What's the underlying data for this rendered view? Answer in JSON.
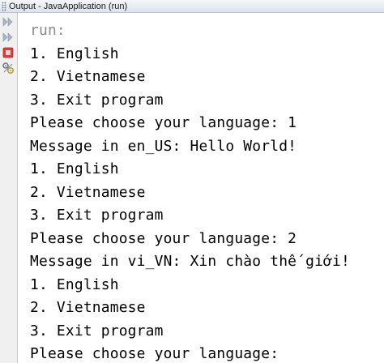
{
  "window": {
    "title": "Output - JavaApplication (run)"
  },
  "toolbar": {
    "buttons": [
      {
        "icon": "rerun-icon"
      },
      {
        "icon": "rerun-with-params-icon"
      },
      {
        "icon": "stop-icon"
      },
      {
        "icon": "settings-icon"
      }
    ]
  },
  "output": {
    "lines": [
      {
        "text": "run:",
        "kind": "meta"
      },
      {
        "text": "1. English"
      },
      {
        "text": "2. Vietnamese"
      },
      {
        "text": "3. Exit program"
      },
      {
        "text": "Please choose your language: 1"
      },
      {
        "text": "Message in en_US: Hello World!"
      },
      {
        "text": "1. English"
      },
      {
        "text": "2. Vietnamese"
      },
      {
        "text": "3. Exit program"
      },
      {
        "text": "Please choose your language: 2"
      },
      {
        "text": "Message in vi_VN: Xin chào thế giới!"
      },
      {
        "text": "1. English"
      },
      {
        "text": "2. Vietnamese"
      },
      {
        "text": "3. Exit program"
      },
      {
        "text": "Please choose your language:"
      }
    ]
  },
  "colors": {
    "meta_text": "#8a8a8a",
    "stop_button": "#d9423a",
    "rerun_arrows": "#a9b6c8"
  }
}
